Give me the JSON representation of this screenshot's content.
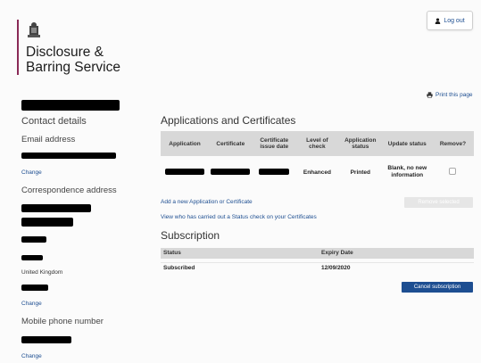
{
  "brand": {
    "name_line1": "Disclosure &",
    "name_line2": "Barring Service"
  },
  "header": {
    "logout_label": "Log out"
  },
  "print_label": "Print this page",
  "contact": {
    "title": "Contact details",
    "email_label": "Email address",
    "change_label": "Change",
    "correspondence_label": "Correspondence address",
    "country": "United Kingdom",
    "mobile_label": "Mobile phone number"
  },
  "applications": {
    "title": "Applications and Certificates",
    "columns": [
      "Application",
      "Certificate",
      "Certificate issue date",
      "Level of check",
      "Application status",
      "Update status",
      "Remove?"
    ],
    "row": {
      "level": "Enhanced",
      "status": "Printed",
      "update_status": "Blank, no new information"
    },
    "add_link": "Add a new Application or Certificate",
    "remove_selected": "Remove selected",
    "status_check_link": "View who has carried out a Status check on your Certificates"
  },
  "subscription": {
    "title": "Subscription",
    "col_status": "Status",
    "col_expiry": "Expiry Date",
    "status": "Subscribed",
    "expiry": "12/09/2020",
    "cancel_label": "Cancel subscription"
  }
}
